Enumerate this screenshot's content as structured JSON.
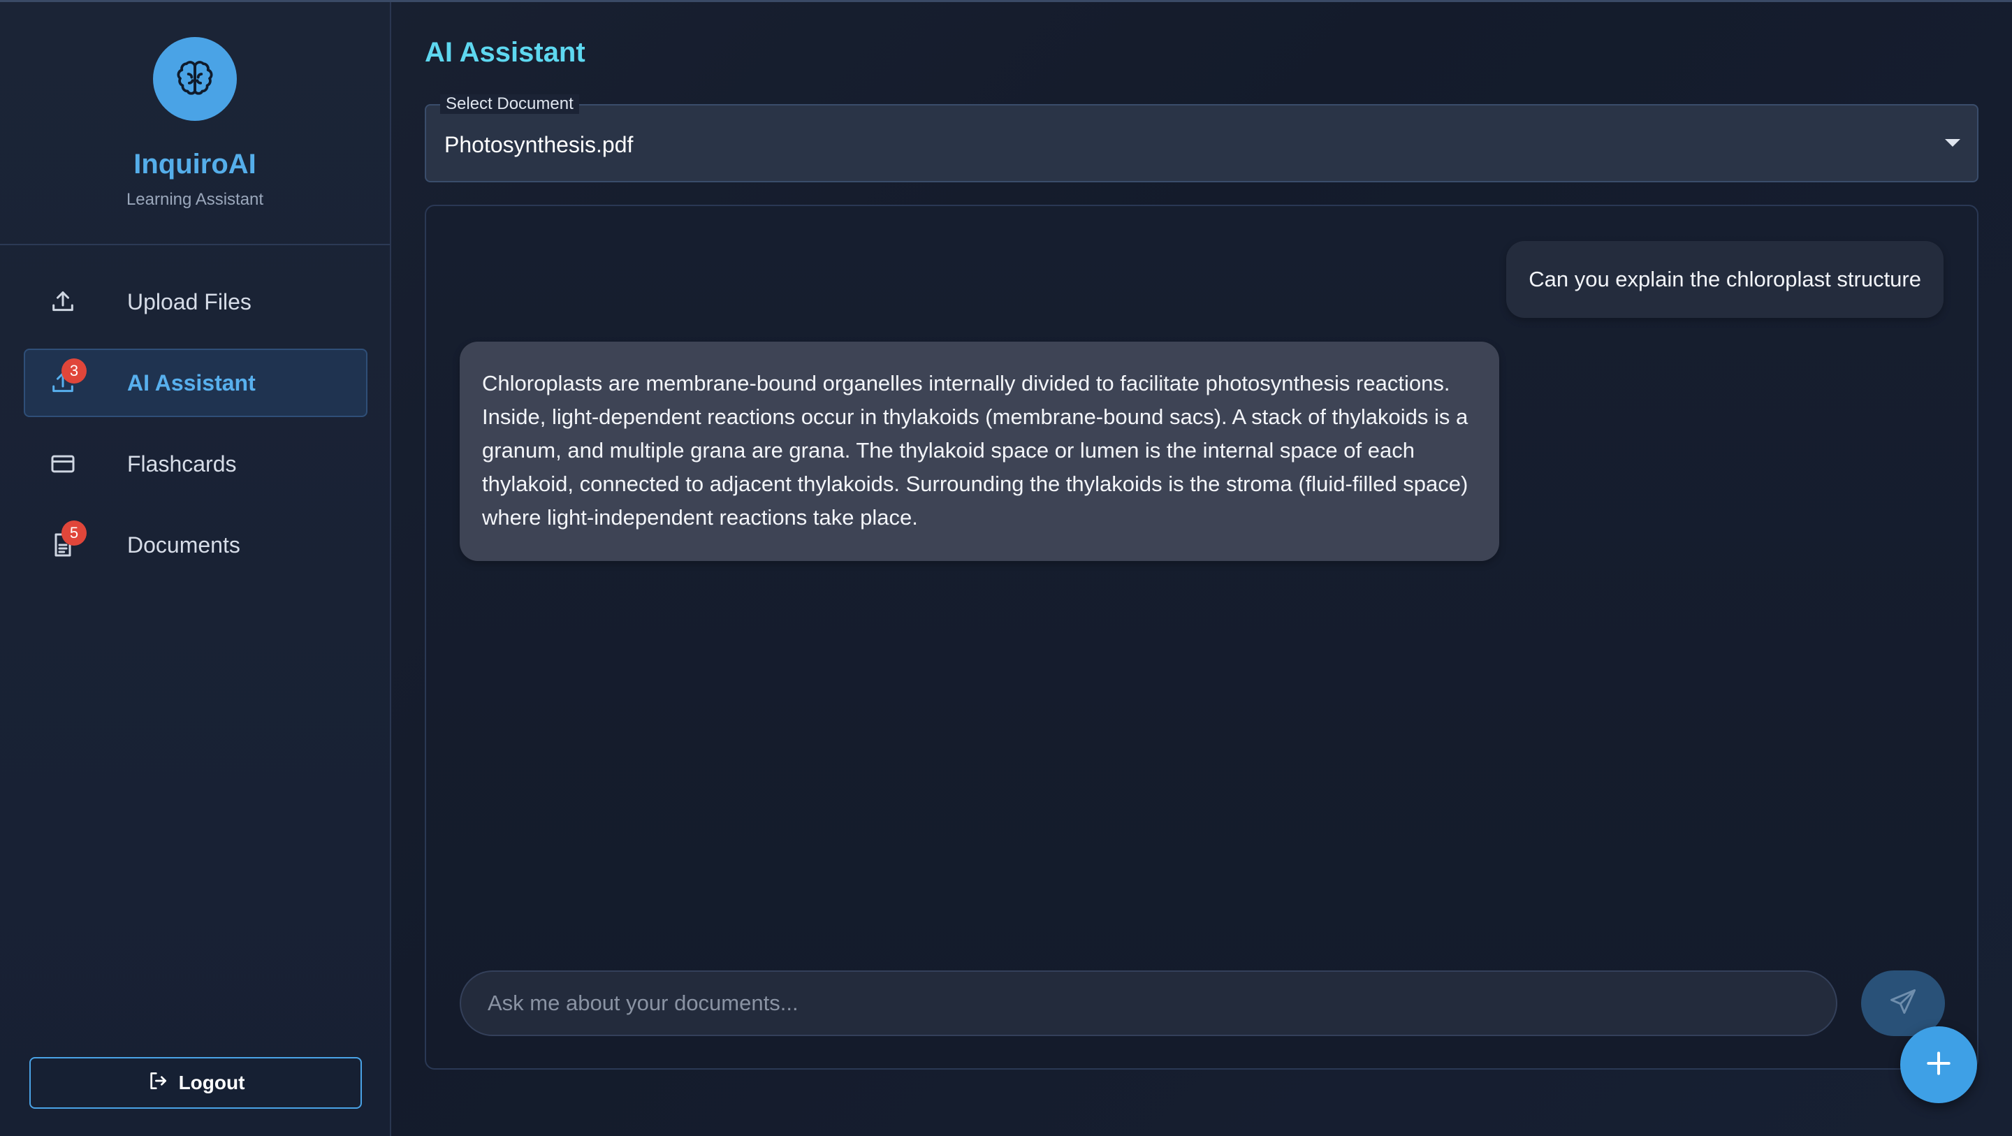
{
  "brand": {
    "name": "InquiroAI",
    "subtitle": "Learning Assistant",
    "icon": "brain-icon"
  },
  "sidebar": {
    "items": [
      {
        "label": "Upload Files",
        "icon": "upload-icon",
        "active": false,
        "badge": null
      },
      {
        "label": "AI Assistant",
        "icon": "upload-icon",
        "active": true,
        "badge": "3"
      },
      {
        "label": "Flashcards",
        "icon": "card-icon",
        "active": false,
        "badge": null
      },
      {
        "label": "Documents",
        "icon": "document-icon",
        "active": false,
        "badge": "5"
      }
    ],
    "logout_label": "Logout"
  },
  "main": {
    "title": "AI Assistant",
    "select": {
      "label": "Select Document",
      "value": "Photosynthesis.pdf"
    },
    "messages": [
      {
        "role": "user",
        "text": "Can you explain the chloroplast structure"
      },
      {
        "role": "assistant",
        "text": "Chloroplasts are membrane-bound organelles internally divided to facilitate photosynthesis reactions. Inside, light-dependent reactions occur in thylakoids (membrane-bound sacs). A stack of thylakoids is a granum, and multiple grana are grana. The thylakoid space or lumen is the internal space of each thylakoid, connected to adjacent thylakoids. Surrounding the thylakoids is the stroma (fluid-filled space) where light-independent reactions take place."
      }
    ],
    "input": {
      "placeholder": "Ask me about your documents...",
      "value": ""
    }
  },
  "colors": {
    "accent": "#4aa3e6",
    "title": "#5ed8f0",
    "badge": "#e0463a"
  }
}
